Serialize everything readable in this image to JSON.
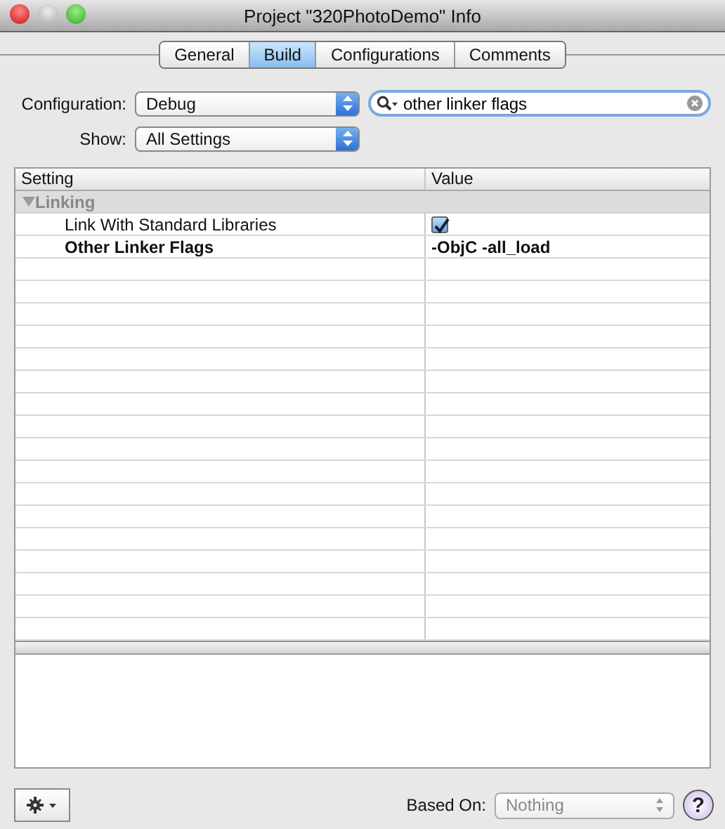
{
  "window": {
    "title": "Project \"320PhotoDemo\" Info"
  },
  "tabs": [
    {
      "label": "General",
      "selected": false
    },
    {
      "label": "Build",
      "selected": true
    },
    {
      "label": "Configurations",
      "selected": false
    },
    {
      "label": "Comments",
      "selected": false
    }
  ],
  "configuration": {
    "label": "Configuration:",
    "value": "Debug"
  },
  "show": {
    "label": "Show:",
    "value": "All Settings"
  },
  "search": {
    "value": "other linker flags"
  },
  "table": {
    "columns": [
      "Setting",
      "Value"
    ],
    "rows": [
      {
        "kind": "group",
        "setting": "Linking",
        "expanded": true
      },
      {
        "kind": "checkbox",
        "setting": "Link With Standard Libraries",
        "checked": true,
        "bold": false
      },
      {
        "kind": "text",
        "setting": "Other Linker Flags",
        "value": "-ObjC -all_load",
        "bold": true
      }
    ]
  },
  "based_on": {
    "label": "Based On:",
    "value": "Nothing",
    "disabled": true
  },
  "help": "?"
}
